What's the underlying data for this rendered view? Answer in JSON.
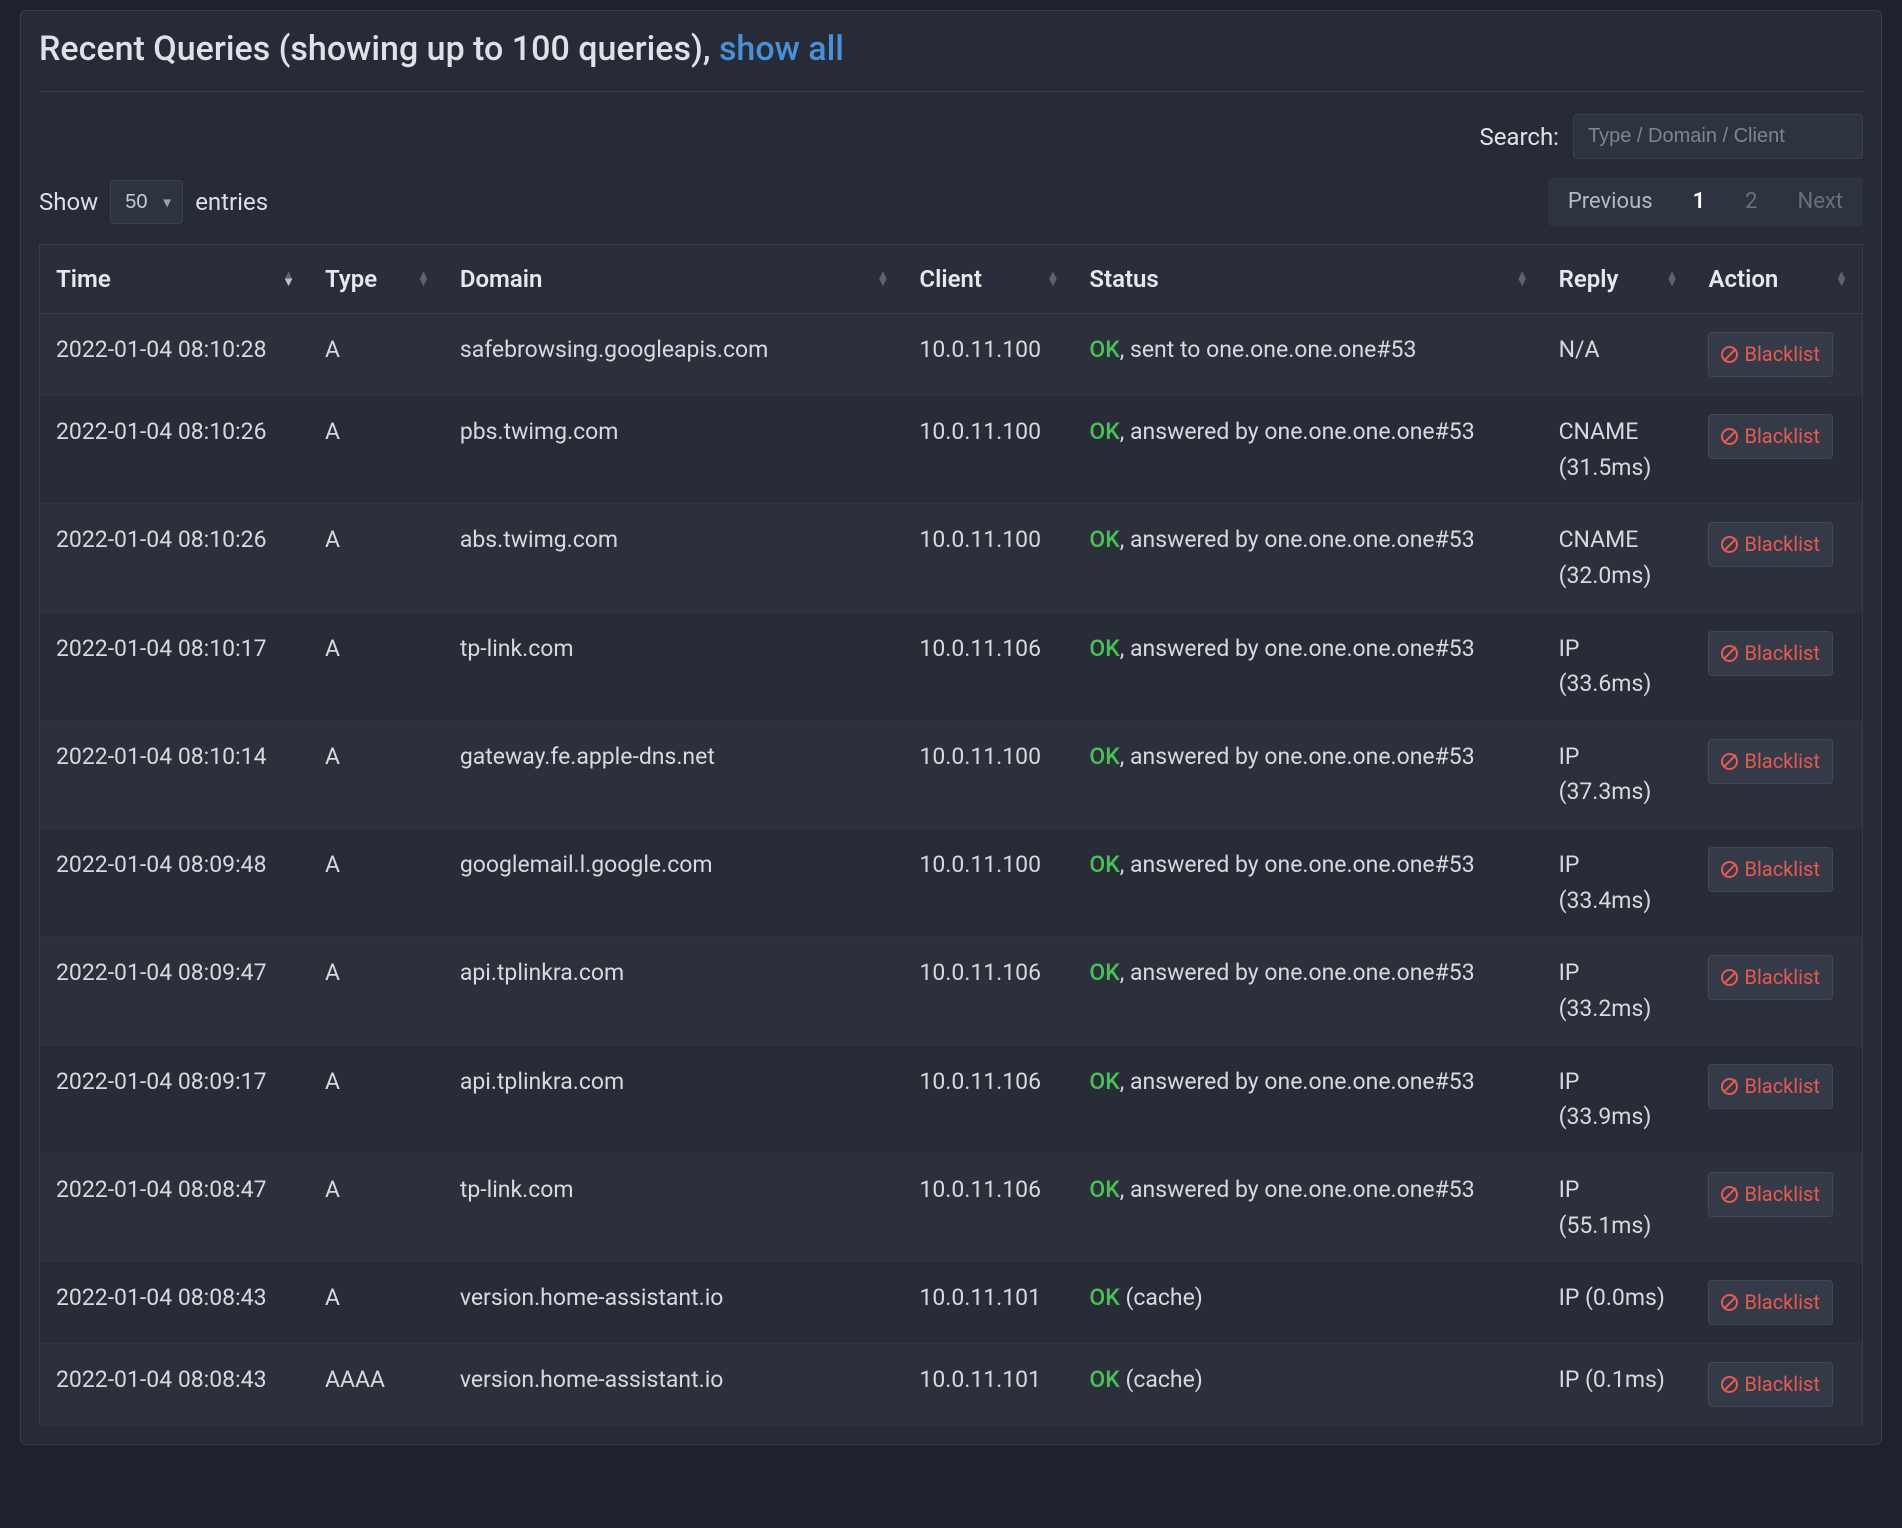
{
  "header": {
    "title_prefix": "Recent Queries (showing up to 100 queries), ",
    "show_all": "show all"
  },
  "search": {
    "label": "Search:",
    "placeholder": "Type / Domain / Client"
  },
  "length": {
    "show": "Show",
    "entries": "entries",
    "value": "50"
  },
  "pagination": {
    "previous": "Previous",
    "page1": "1",
    "page2": "2",
    "next": "Next"
  },
  "columns": {
    "time": "Time",
    "type": "Type",
    "domain": "Domain",
    "client": "Client",
    "status": "Status",
    "reply": "Reply",
    "action": "Action"
  },
  "action_label": "Blacklist",
  "rows": [
    {
      "time": "2022-01-04 08:10:28",
      "type": "A",
      "domain": "safebrowsing.googleapis.com",
      "client": "10.0.11.100",
      "ok": "OK",
      "status_rest": ", sent to one.one.one.one#53",
      "reply": "N/A"
    },
    {
      "time": "2022-01-04 08:10:26",
      "type": "A",
      "domain": "pbs.twimg.com",
      "client": "10.0.11.100",
      "ok": "OK",
      "status_rest": ", answered by one.one.one.one#53",
      "reply": "CNAME (31.5ms)"
    },
    {
      "time": "2022-01-04 08:10:26",
      "type": "A",
      "domain": "abs.twimg.com",
      "client": "10.0.11.100",
      "ok": "OK",
      "status_rest": ", answered by one.one.one.one#53",
      "reply": "CNAME (32.0ms)"
    },
    {
      "time": "2022-01-04 08:10:17",
      "type": "A",
      "domain": "tp-link.com",
      "client": "10.0.11.106",
      "ok": "OK",
      "status_rest": ", answered by one.one.one.one#53",
      "reply": "IP (33.6ms)"
    },
    {
      "time": "2022-01-04 08:10:14",
      "type": "A",
      "domain": "gateway.fe.apple-dns.net",
      "client": "10.0.11.100",
      "ok": "OK",
      "status_rest": ", answered by one.one.one.one#53",
      "reply": "IP (37.3ms)"
    },
    {
      "time": "2022-01-04 08:09:48",
      "type": "A",
      "domain": "googlemail.l.google.com",
      "client": "10.0.11.100",
      "ok": "OK",
      "status_rest": ", answered by one.one.one.one#53",
      "reply": "IP (33.4ms)"
    },
    {
      "time": "2022-01-04 08:09:47",
      "type": "A",
      "domain": "api.tplinkra.com",
      "client": "10.0.11.106",
      "ok": "OK",
      "status_rest": ", answered by one.one.one.one#53",
      "reply": "IP (33.2ms)"
    },
    {
      "time": "2022-01-04 08:09:17",
      "type": "A",
      "domain": "api.tplinkra.com",
      "client": "10.0.11.106",
      "ok": "OK",
      "status_rest": ", answered by one.one.one.one#53",
      "reply": "IP (33.9ms)"
    },
    {
      "time": "2022-01-04 08:08:47",
      "type": "A",
      "domain": "tp-link.com",
      "client": "10.0.11.106",
      "ok": "OK",
      "status_rest": ", answered by one.one.one.one#53",
      "reply": "IP (55.1ms)"
    },
    {
      "time": "2022-01-04 08:08:43",
      "type": "A",
      "domain": "version.home-assistant.io",
      "client": "10.0.11.101",
      "ok": "OK",
      "status_rest": " (cache)",
      "reply": "IP (0.0ms)"
    },
    {
      "time": "2022-01-04 08:08:43",
      "type": "AAAA",
      "domain": "version.home-assistant.io",
      "client": "10.0.11.101",
      "ok": "OK",
      "status_rest": " (cache)",
      "reply": "IP (0.1ms)"
    }
  ]
}
